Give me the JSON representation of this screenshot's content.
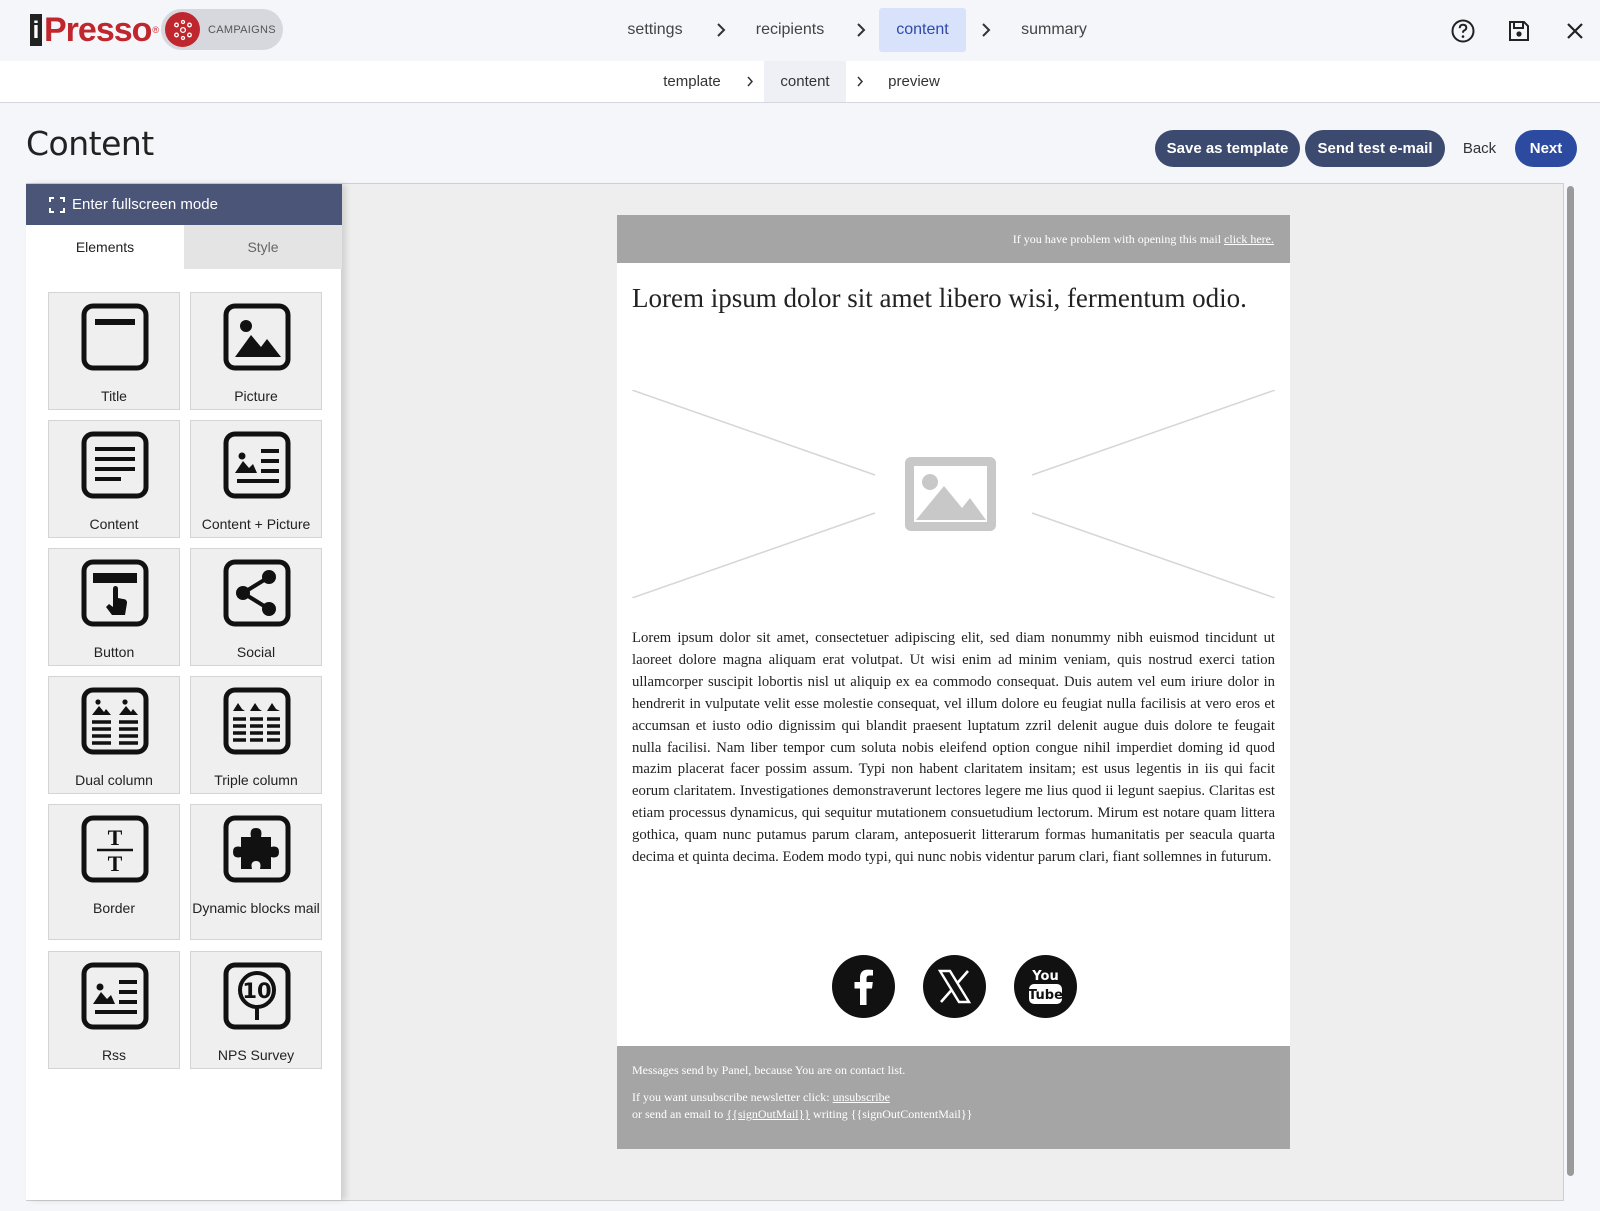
{
  "brand": {
    "logo_text": "Presso",
    "logo_i": "i",
    "logo_reg": "®",
    "module_label": "CAMPAIGNS",
    "accent": "#c0262d"
  },
  "wizard": {
    "steps": [
      "settings",
      "recipients",
      "content",
      "summary"
    ],
    "active_step": "content",
    "substeps": [
      "template",
      "content",
      "preview"
    ],
    "active_substep": "content"
  },
  "top_icons": [
    "help-circle-icon",
    "save-disk-icon",
    "close-icon"
  ],
  "page": {
    "title": "Content",
    "actions": {
      "save_template": "Save as template",
      "send_test": "Send test e-mail",
      "back": "Back",
      "next": "Next"
    }
  },
  "sidebar": {
    "fullscreen_label": "Enter fullscreen mode",
    "tabs": [
      "Elements",
      "Style"
    ],
    "active_tab": "Elements",
    "elements": [
      {
        "label": "Title",
        "icon": "title-block-icon"
      },
      {
        "label": "Picture",
        "icon": "picture-block-icon"
      },
      {
        "label": "Content",
        "icon": "content-block-icon"
      },
      {
        "label": "Content + Picture",
        "icon": "content-picture-block-icon"
      },
      {
        "label": "Button",
        "icon": "button-block-icon"
      },
      {
        "label": "Social",
        "icon": "social-share-icon"
      },
      {
        "label": "Dual column",
        "icon": "dual-column-icon"
      },
      {
        "label": "Triple column",
        "icon": "triple-column-icon"
      },
      {
        "label": "Border",
        "icon": "border-block-icon"
      },
      {
        "label": "Dynamic blocks mail",
        "icon": "puzzle-piece-icon"
      },
      {
        "label": "Rss",
        "icon": "rss-block-icon"
      },
      {
        "label": "NPS Survey",
        "icon": "nps-survey-icon"
      }
    ]
  },
  "email": {
    "top_notice": "If you have problem with opening this mail",
    "top_link": "click here.",
    "headline": "Lorem ipsum dolor sit amet libero wisi, fermentum odio.",
    "body": "Lorem ipsum dolor sit amet, consectetuer adipiscing elit, sed diam nonummy nibh euismod tincidunt ut laoreet dolore magna aliquam erat volutpat. Ut wisi enim ad minim veniam, quis nostrud exerci tation ullamcorper suscipit lobortis nisl ut aliquip ex ea commodo consequat. Duis autem vel eum iriure dolor in hendrerit in vulputate velit esse molestie consequat, vel illum dolore eu feugiat nulla facilisis at vero eros et accumsan et iusto odio dignissim qui blandit praesent luptatum zzril delenit augue duis dolore te feugait nulla facilisi. Nam liber tempor cum soluta nobis eleifend option congue nihil imperdiet doming id quod mazim placerat facer possim assum. Typi non habent claritatem insitam; est usus legentis in iis qui facit eorum claritatem. Investigationes demonstraverunt lectores legere me lius quod ii legunt saepius. Claritas est etiam processus dynamicus, qui sequitur mutationem consuetudium lectorum. Mirum est notare quam littera gothica, quam nunc putamus parum claram, anteposuerit litterarum formas humanitatis per seacula quarta decima et quinta decima. Eodem modo typi, qui nunc nobis videntur parum clari, fiant sollemnes in futurum.",
    "social": [
      "facebook-icon",
      "x-icon",
      "youtube-icon"
    ],
    "youtube_you": "You",
    "youtube_tube": "Tube",
    "footer_line1": "Messages send by Panel, because You are on contact list.",
    "footer_unsub_prefix": "If you want unsubscribe newsletter click:",
    "footer_unsub_link": "unsubscribe",
    "footer_mail_prefix": "or send an email to",
    "footer_mail_var": "{{signOutMail}}",
    "footer_mail_writing": "writing",
    "footer_mail_content": "{{signOutContentMail}}"
  },
  "colors": {
    "nav_active_bg": "#d9e2fb",
    "nav_active_text": "#2f4aa8",
    "button_dark": "#3b4a6e",
    "button_primary": "#2c4ba0",
    "fullscreen_bar": "#4a5578",
    "email_band": "#a5a5a5"
  }
}
